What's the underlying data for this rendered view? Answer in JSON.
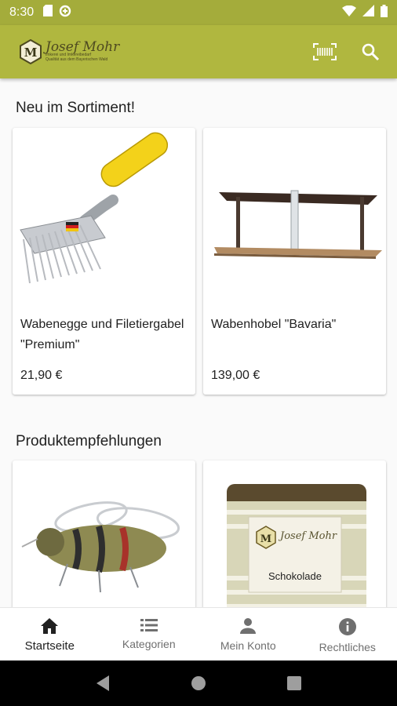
{
  "status_bar": {
    "time": "8:30",
    "icons": [
      "sd-card-icon",
      "data-saver-icon",
      "wifi-icon",
      "signal-icon",
      "battery-icon"
    ]
  },
  "app_bar": {
    "brand_letter": "M",
    "brand_name": "Josef Mohr",
    "brand_tagline_1": "Imkerei und Imkereibedarf",
    "brand_tagline_2": "Qualität aus dem Bayerischen Wald",
    "actions": [
      "barcode-scan-icon",
      "search-icon"
    ]
  },
  "sections": [
    {
      "title": "Neu im Sortiment!",
      "products": [
        {
          "name": "Wabenegge und Filetiergabel \"Premium\"",
          "price": "21,90 €",
          "image": "uncapping-fork-image"
        },
        {
          "name": "Wabenhobel \"Bavaria\"",
          "price": "139,00 €",
          "image": "comb-plane-image"
        }
      ]
    },
    {
      "title": "Produktempfehlungen",
      "products": [
        {
          "name": "",
          "price": "",
          "image": "metal-bee-sculpture-image"
        },
        {
          "name": "",
          "price": "",
          "image": "chocolate-package-image",
          "image_label": "Schokolade"
        }
      ]
    }
  ],
  "bottom_nav": [
    {
      "label": "Startseite",
      "icon": "home-icon",
      "active": true
    },
    {
      "label": "Kategorien",
      "icon": "list-icon",
      "active": false
    },
    {
      "label": "Mein Konto",
      "icon": "person-icon",
      "active": false
    },
    {
      "label": "Rechtliches",
      "icon": "info-icon",
      "active": false
    }
  ],
  "colors": {
    "status_bar": "#a4ac3b",
    "app_bar": "#b0b73f",
    "background": "#fafafa"
  }
}
